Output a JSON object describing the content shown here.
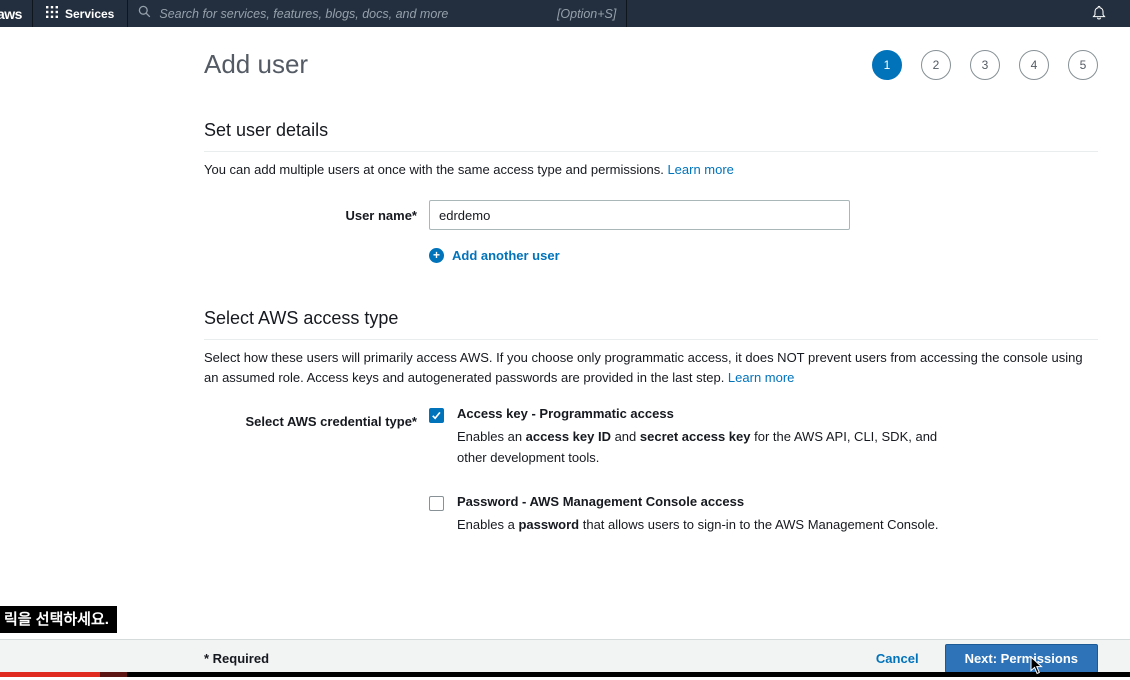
{
  "topnav": {
    "logo": "aws",
    "services_label": "Services",
    "search": {
      "placeholder": "Search for services, features, blogs, docs, and more",
      "shortcut": "[Option+S]"
    }
  },
  "page": {
    "title": "Add user",
    "steps": [
      "1",
      "2",
      "3",
      "4",
      "5"
    ],
    "active_step": "1"
  },
  "user_details": {
    "heading": "Set user details",
    "intro": "You can add multiple users at once with the same access type and permissions. ",
    "learn_more": "Learn more",
    "username_label": "User name*",
    "username_value": "edrdemo",
    "add_another": "Add another user"
  },
  "access_type": {
    "heading": "Select AWS access type",
    "intro": "Select how these users will primarily access AWS. If you choose only programmatic access, it does NOT prevent users from accessing the console using an assumed role. Access keys and autogenerated passwords are provided in the last step. ",
    "learn_more": "Learn more",
    "credential_label": "Select AWS credential type*",
    "options": [
      {
        "title": "Access key - Programmatic access",
        "checked": true,
        "desc": [
          "Enables an ",
          "access key ID",
          " and ",
          "secret access key",
          " for the AWS API, CLI, SDK, and other development tools."
        ]
      },
      {
        "title": "Password - AWS Management Console access",
        "checked": false,
        "desc": [
          "Enables a ",
          "password",
          " that allows users to sign-in to the AWS Management Console."
        ]
      }
    ]
  },
  "footer": {
    "required_note": "* Required",
    "cancel_label": "Cancel",
    "next_label": "Next: Permissions"
  },
  "caption": {
    "text": "릭을 선택하세요."
  },
  "colors": {
    "accent_blue": "#0073bb",
    "nav_background": "#232f3e",
    "next_button": "#2e73b8",
    "active_step": "#0073bb",
    "video_progress_red": "#e02b20"
  }
}
